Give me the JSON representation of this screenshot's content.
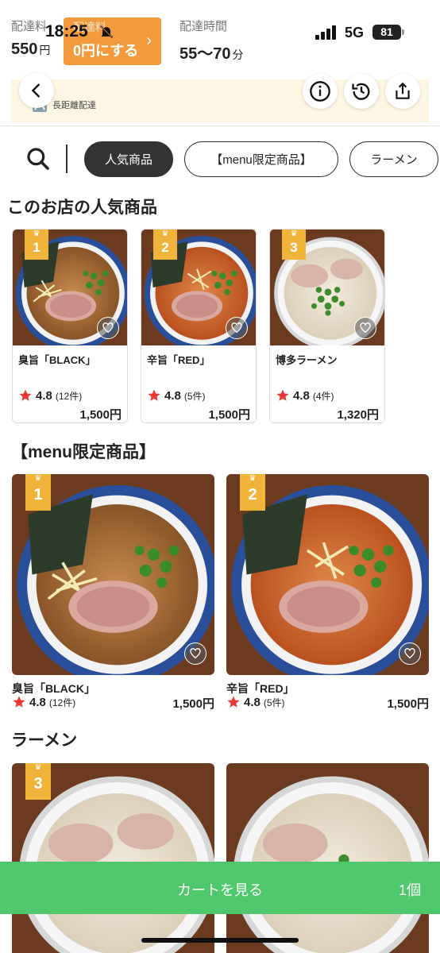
{
  "status_bar": {
    "time": "18:25",
    "network": "5G",
    "battery": "81"
  },
  "delivery": {
    "fee_label": "配達料",
    "fee_value": "550",
    "fee_unit": "円",
    "promo_label": "配達料",
    "promo_text": "0円にする",
    "time_label": "配達時間",
    "time_value": "55〜70",
    "time_unit": "分"
  },
  "header": {
    "subtitle": "長距離配達"
  },
  "tabs": [
    {
      "label": "人気商品",
      "active": true
    },
    {
      "label": "【menu限定商品】",
      "active": false
    },
    {
      "label": "ラーメン",
      "active": false
    }
  ],
  "popular": {
    "title": "このお店の人気商品",
    "items": [
      {
        "rank": "1",
        "name": "臭旨「BLACK」",
        "rating": "4.8",
        "count": "(12件)",
        "price": "1,500円"
      },
      {
        "rank": "2",
        "name": "辛旨「RED」",
        "rating": "4.8",
        "count": "(5件)",
        "price": "1,500円"
      },
      {
        "rank": "3",
        "name": "博多ラーメン",
        "rating": "4.8",
        "count": "(4件)",
        "price": "1,320円"
      }
    ]
  },
  "limited": {
    "title": "【menu限定商品】",
    "items": [
      {
        "rank": "1",
        "name": "臭旨「BLACK」",
        "rating": "4.8",
        "count": "(12件)",
        "price": "1,500円"
      },
      {
        "rank": "2",
        "name": "辛旨「RED」",
        "rating": "4.8",
        "count": "(5件)",
        "price": "1,500円"
      }
    ]
  },
  "ramen": {
    "title": "ラーメン",
    "items": [
      {
        "rank": "3"
      },
      {
        "rank": ""
      }
    ]
  },
  "cart": {
    "label": "カートを見る",
    "quantity": "1個"
  },
  "colors": {
    "accent": "#f39a3c",
    "cart": "#4fc76b",
    "star": "#e53935",
    "badge": "#f0b43a"
  }
}
